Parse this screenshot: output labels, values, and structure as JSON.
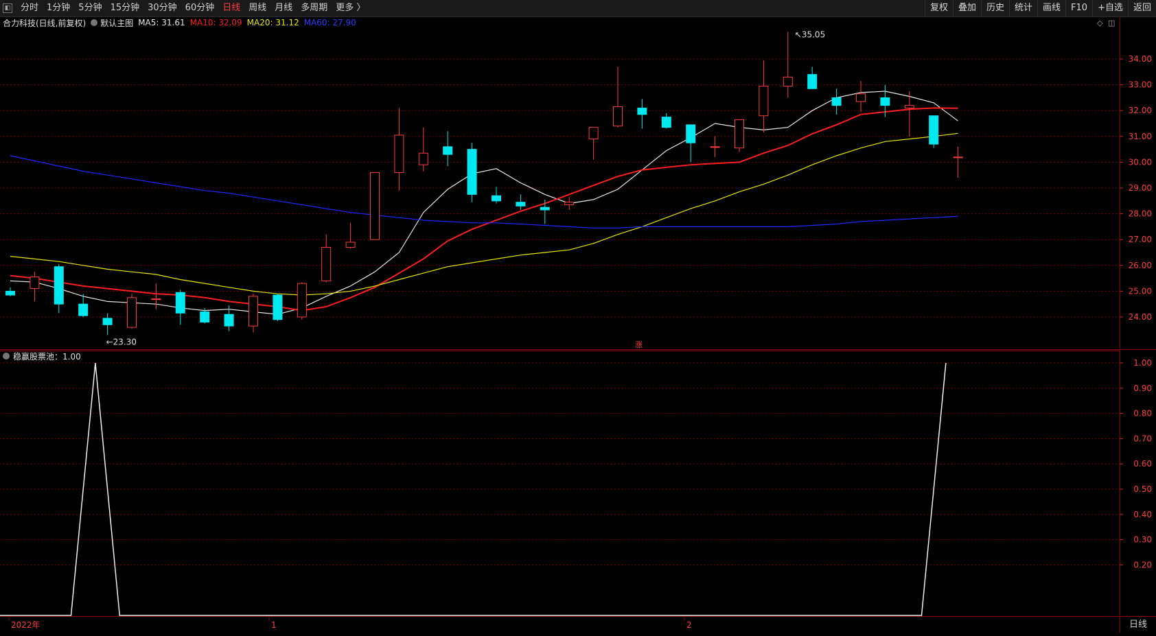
{
  "toolbar": {
    "tabs": [
      "分时",
      "1分钟",
      "5分钟",
      "15分钟",
      "30分钟",
      "60分钟",
      "日线",
      "周线",
      "月线",
      "多周期",
      "更多 〉"
    ],
    "active_tab": "日线",
    "right_buttons": [
      "复权",
      "叠加",
      "历史",
      "统计",
      "画线",
      "F10",
      "+自选",
      "返回"
    ]
  },
  "legend": {
    "stock": "合力科技(日线,前复权)",
    "template": "默认主图",
    "ma5": "MA5: 31.61",
    "ma10": "MA10: 32.09",
    "ma20": "MA20: 31.12",
    "ma60": "MA60: 27.90"
  },
  "indicator_legend": "稳赢股票池：1.00",
  "price_labels": {
    "high": "35.05",
    "low": "23.30",
    "mid_marker": "涨"
  },
  "colors": {
    "up": "#ff3c3c",
    "down": "#00e8f0",
    "ma5": "#e8e8e8",
    "ma10": "#ff1e1e",
    "ma20": "#e8e800",
    "ma60": "#1e28ff",
    "grid": "#6a0000"
  },
  "bottom_axis": {
    "labels": [
      "2022年",
      "1",
      "2"
    ],
    "period": "日线"
  },
  "chart_data": [
    {
      "type": "candlestick",
      "title": "合力科技(日线,前复权)",
      "y_ticks": [
        34,
        33,
        32,
        31,
        30,
        29,
        28,
        27,
        26,
        25,
        24
      ],
      "ylim": [
        22.85,
        35.85
      ],
      "candles": [
        {
          "o": 25.0,
          "c": 24.85,
          "h": 25.15,
          "l": 24.8
        },
        {
          "o": 25.1,
          "c": 25.55,
          "h": 25.75,
          "l": 24.6
        },
        {
          "o": 25.95,
          "c": 24.5,
          "h": 26.05,
          "l": 24.15
        },
        {
          "o": 24.5,
          "c": 24.05,
          "h": 24.9,
          "l": 24.0
        },
        {
          "o": 23.95,
          "c": 23.7,
          "h": 24.15,
          "l": 23.3
        },
        {
          "o": 23.6,
          "c": 24.75,
          "h": 24.9,
          "l": 23.55
        },
        {
          "o": 24.7,
          "c": 24.7,
          "h": 25.3,
          "l": 24.3
        },
        {
          "o": 24.95,
          "c": 24.15,
          "h": 25.05,
          "l": 23.7
        },
        {
          "o": 24.2,
          "c": 23.8,
          "h": 24.35,
          "l": 23.75
        },
        {
          "o": 24.1,
          "c": 23.65,
          "h": 24.45,
          "l": 23.45
        },
        {
          "o": 23.65,
          "c": 24.8,
          "h": 24.9,
          "l": 23.4
        },
        {
          "o": 24.85,
          "c": 23.9,
          "h": 24.9,
          "l": 23.85
        },
        {
          "o": 24.0,
          "c": 25.3,
          "h": 25.35,
          "l": 23.9
        },
        {
          "o": 25.4,
          "c": 26.7,
          "h": 27.2,
          "l": 25.35
        },
        {
          "o": 26.7,
          "c": 26.9,
          "h": 27.65,
          "l": 26.65
        },
        {
          "o": 27.0,
          "c": 29.6,
          "h": 29.6,
          "l": 27.0
        },
        {
          "o": 29.6,
          "c": 31.05,
          "h": 32.1,
          "l": 28.9
        },
        {
          "o": 29.9,
          "c": 30.35,
          "h": 31.35,
          "l": 29.65
        },
        {
          "o": 30.6,
          "c": 30.3,
          "h": 31.2,
          "l": 29.85
        },
        {
          "o": 30.5,
          "c": 28.75,
          "h": 30.75,
          "l": 28.45
        },
        {
          "o": 28.7,
          "c": 28.5,
          "h": 29.05,
          "l": 28.4
        },
        {
          "o": 28.45,
          "c": 28.3,
          "h": 28.75,
          "l": 28.15
        },
        {
          "o": 28.25,
          "c": 28.15,
          "h": 28.55,
          "l": 27.6
        },
        {
          "o": 28.35,
          "c": 28.45,
          "h": 28.65,
          "l": 28.15
        },
        {
          "o": 30.9,
          "c": 31.35,
          "h": 31.35,
          "l": 30.1
        },
        {
          "o": 31.4,
          "c": 32.15,
          "h": 33.7,
          "l": 31.35
        },
        {
          "o": 32.1,
          "c": 31.85,
          "h": 32.45,
          "l": 31.3
        },
        {
          "o": 31.75,
          "c": 31.35,
          "h": 31.9,
          "l": 31.3
        },
        {
          "o": 31.45,
          "c": 30.75,
          "h": 31.45,
          "l": 30.0
        },
        {
          "o": 30.6,
          "c": 30.6,
          "h": 31.0,
          "l": 30.2
        },
        {
          "o": 30.55,
          "c": 31.65,
          "h": 31.65,
          "l": 30.4
        },
        {
          "o": 31.8,
          "c": 32.95,
          "h": 33.95,
          "l": 31.15
        },
        {
          "o": 32.95,
          "c": 33.3,
          "h": 35.05,
          "l": 32.5
        },
        {
          "o": 33.4,
          "c": 32.85,
          "h": 33.7,
          "l": 32.85
        },
        {
          "o": 32.5,
          "c": 32.2,
          "h": 32.85,
          "l": 31.85
        },
        {
          "o": 32.35,
          "c": 32.65,
          "h": 33.15,
          "l": 31.95
        },
        {
          "o": 32.5,
          "c": 32.2,
          "h": 33.0,
          "l": 31.75
        },
        {
          "o": 32.1,
          "c": 32.2,
          "h": 32.75,
          "l": 31.0
        },
        {
          "o": 31.8,
          "c": 30.7,
          "h": 31.8,
          "l": 30.55
        },
        {
          "o": 30.2,
          "c": 30.2,
          "h": 30.6,
          "l": 29.4
        }
      ],
      "series": [
        {
          "name": "MA5",
          "values": [
            25.4,
            25.35,
            25.1,
            24.8,
            24.6,
            24.55,
            24.5,
            24.35,
            24.25,
            24.3,
            24.2,
            24.1,
            24.35,
            24.8,
            25.2,
            25.75,
            26.5,
            28.05,
            28.95,
            29.55,
            29.75,
            29.2,
            28.75,
            28.4,
            28.55,
            28.95,
            29.7,
            30.45,
            30.95,
            31.5,
            31.35,
            31.25,
            31.35,
            32.0,
            32.5,
            32.7,
            32.75,
            32.55,
            32.3,
            31.6
          ]
        },
        {
          "name": "MA10",
          "values": [
            25.6,
            25.5,
            25.35,
            25.2,
            25.1,
            25.0,
            24.9,
            24.85,
            24.75,
            24.6,
            24.5,
            24.4,
            24.25,
            24.4,
            24.75,
            25.15,
            25.7,
            26.25,
            26.95,
            27.4,
            27.75,
            28.1,
            28.4,
            28.75,
            29.1,
            29.45,
            29.7,
            29.8,
            29.9,
            29.95,
            30.0,
            30.35,
            30.65,
            31.1,
            31.45,
            31.85,
            31.95,
            32.05,
            32.1,
            32.09
          ]
        },
        {
          "name": "MA20",
          "values": [
            26.35,
            26.25,
            26.15,
            26.0,
            25.85,
            25.75,
            25.65,
            25.45,
            25.3,
            25.15,
            25.0,
            24.9,
            24.85,
            24.9,
            25.0,
            25.2,
            25.45,
            25.7,
            25.95,
            26.1,
            26.25,
            26.4,
            26.5,
            26.6,
            26.85,
            27.2,
            27.5,
            27.85,
            28.2,
            28.5,
            28.85,
            29.15,
            29.5,
            29.9,
            30.25,
            30.55,
            30.8,
            30.9,
            31.0,
            31.12
          ]
        },
        {
          "name": "MA60",
          "values": [
            30.25,
            30.05,
            29.85,
            29.65,
            29.5,
            29.35,
            29.2,
            29.05,
            28.9,
            28.8,
            28.65,
            28.5,
            28.35,
            28.2,
            28.05,
            27.95,
            27.85,
            27.75,
            27.7,
            27.65,
            27.65,
            27.6,
            27.55,
            27.5,
            27.45,
            27.45,
            27.5,
            27.5,
            27.5,
            27.5,
            27.5,
            27.5,
            27.5,
            27.55,
            27.6,
            27.7,
            27.75,
            27.8,
            27.85,
            27.9
          ]
        }
      ]
    },
    {
      "type": "line",
      "title": "稳赢股票池",
      "y_ticks": [
        1.0,
        0.9,
        0.8,
        0.7,
        0.6,
        0.5,
        0.4,
        0.3,
        0.2
      ],
      "ylim": [
        0,
        1.035
      ],
      "x_start": -0.5,
      "series": [
        {
          "name": "稳赢股票池",
          "values": [
            0,
            0,
            0,
            0,
            1,
            0,
            0,
            0,
            0,
            0,
            0,
            0,
            0,
            0,
            0,
            0,
            0,
            0,
            0,
            0,
            0,
            0,
            0,
            0,
            0,
            0,
            0,
            0,
            0,
            0,
            0,
            0,
            0,
            0,
            0,
            0,
            0,
            0,
            0,
            1
          ]
        }
      ]
    }
  ]
}
